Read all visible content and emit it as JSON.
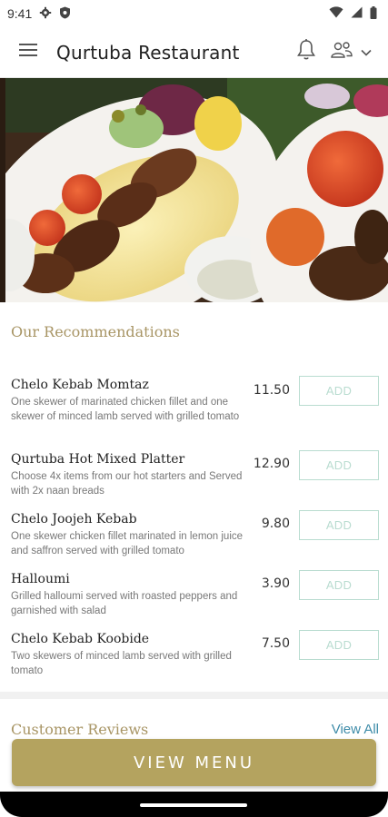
{
  "status": {
    "time": "9:41",
    "icons": [
      "gear-icon",
      "shield-icon",
      "wifi-icon",
      "signal-icon",
      "battery-icon"
    ]
  },
  "app_bar": {
    "title": "Qurtuba Restaurant",
    "icons": [
      "hamburger-menu-icon",
      "bell-icon",
      "users-icon",
      "chevron-down-icon"
    ]
  },
  "recommendations": {
    "title": "Our Recommendations",
    "items": [
      {
        "name": "Chelo Kebab Momtaz",
        "desc": "One skewer of marinated chicken fillet and one skewer of minced lamb served with grilled tomato",
        "price": "11.50",
        "add": "ADD"
      },
      {
        "name": "Qurtuba Hot Mixed Platter",
        "desc": "Choose 4x items from our hot starters and Served with 2x naan breads",
        "price": "12.90",
        "add": "ADD"
      },
      {
        "name": "Chelo Joojeh Kebab",
        "desc": "One skewer chicken fillet marinated in lemon juice and saffron served with grilled tomato",
        "price": "9.80",
        "add": "ADD"
      },
      {
        "name": "Halloumi",
        "desc": "Grilled halloumi served with roasted peppers and garnished with salad",
        "price": "3.90",
        "add": "ADD"
      },
      {
        "name": "Chelo Kebab Koobide",
        "desc": "Two skewers of minced lamb served with grilled tomato",
        "price": "7.50",
        "add": "ADD"
      }
    ]
  },
  "reviews": {
    "title": "Customer Reviews",
    "view_all": "View All"
  },
  "cta": {
    "label": "VIEW MENU"
  },
  "colors": {
    "accent_gold": "#b4a35f",
    "section_title": "#a89565",
    "add_border": "#b9dcd0",
    "link_blue": "#3d8ba8"
  }
}
